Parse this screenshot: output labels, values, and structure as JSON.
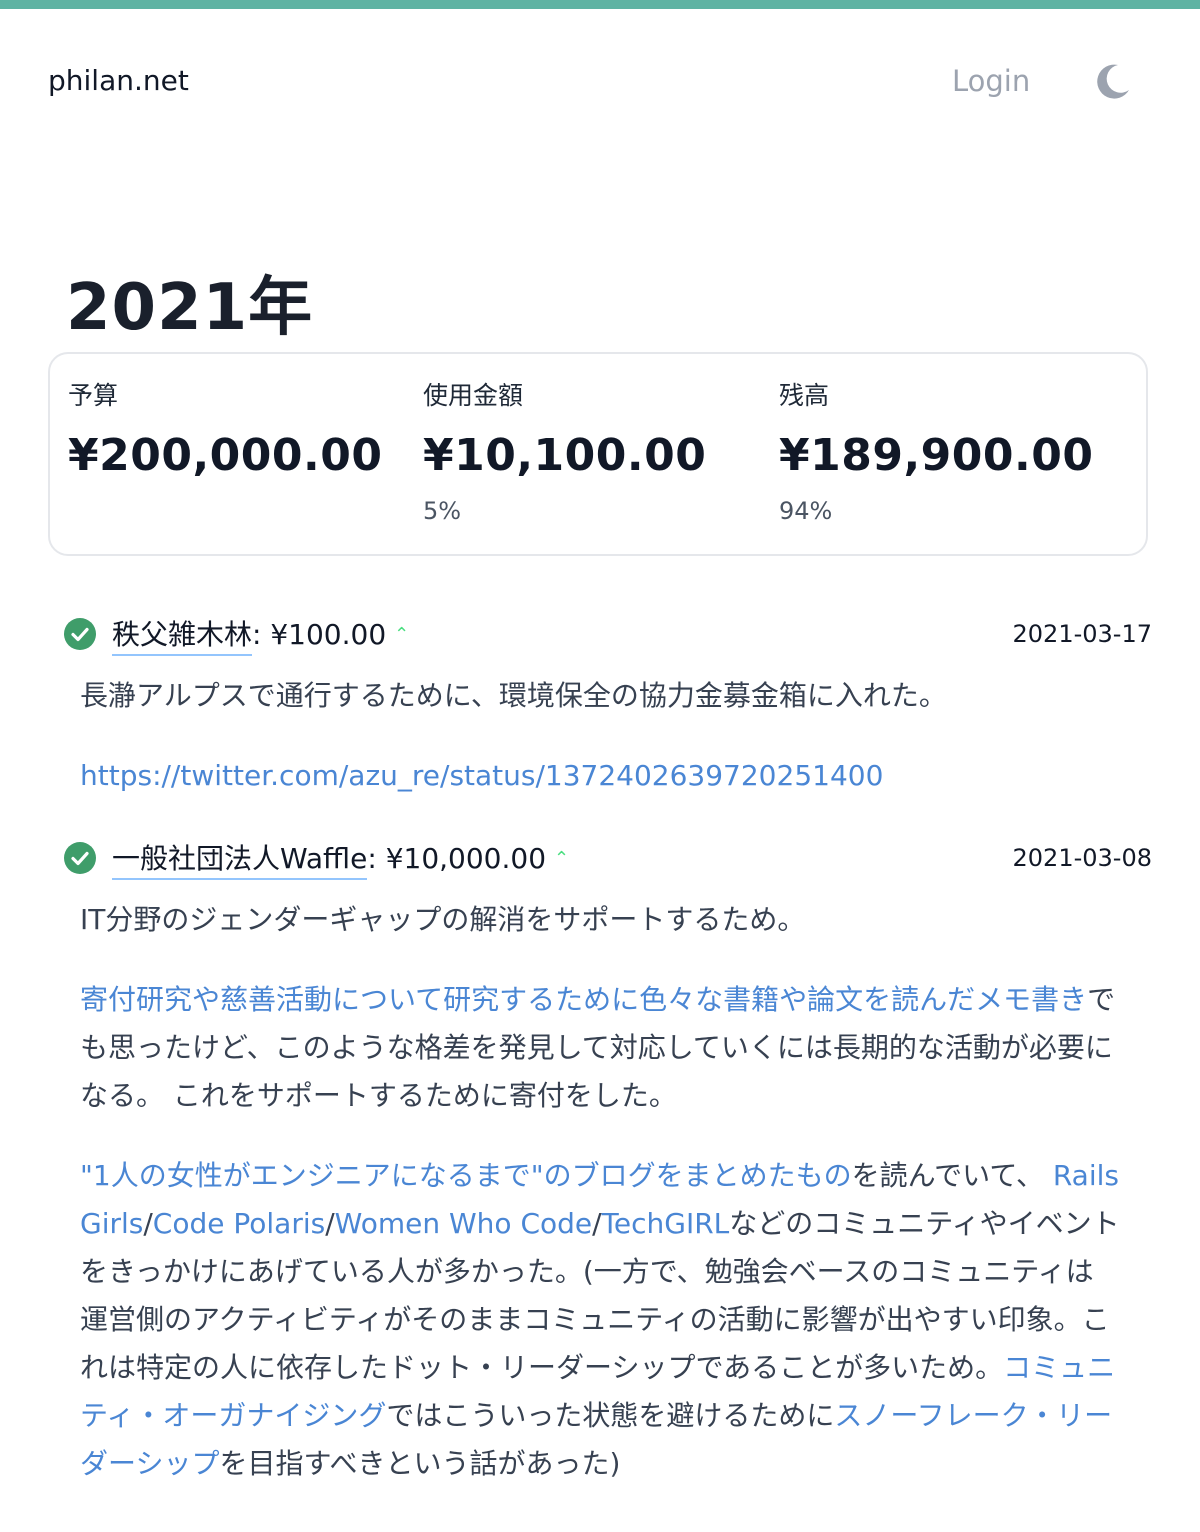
{
  "header": {
    "site_title": "philan.net",
    "login_label": "Login",
    "theme_icon": "moon-icon",
    "accent_color": "#5fb3a3"
  },
  "page": {
    "year_title": "2021年"
  },
  "summary": {
    "budget_label": "予算",
    "budget_value": "¥200,000.00",
    "spent_label": "使用金額",
    "spent_value": "¥10,100.00",
    "spent_pct": "5%",
    "remaining_label": "残高",
    "remaining_value": "¥189,900.00",
    "remaining_pct": "94%"
  },
  "entries": [
    {
      "status_icon": "check-circle-icon",
      "org": "秩父雑木林",
      "amount": ": ¥100.00",
      "date": "2021-03-17",
      "body": "長瀞アルプスで通行するために、環境保全の協力金募金箱に入れた。",
      "link": "https://twitter.com/azu_re/status/1372402639720251400"
    },
    {
      "status_icon": "check-circle-icon",
      "org": "一般社団法人Waffle",
      "amount": " : ¥10,000.00",
      "date": "2021-03-08",
      "body": "IT分野のジェンダーギャップの解消をサポートするため。",
      "p2_link": "寄付研究や慈善活動について研究するために色々な書籍や論文を読んだメモ書き",
      "p2_text": "でも思ったけど、このような格差を発見して対応していくには長期的な活動が必要になる。 これをサポートするために寄付をした。",
      "p3_link1": "\"1人の女性がエンジニアになるまで\"のブログをまとめたもの",
      "p3_text1": "を読んでいて、 ",
      "p3_link2": "Rails Girls",
      "p3_link3": "Code Polaris",
      "p3_link4": "Women Who Code",
      "p3_link5": "TechGIRL",
      "p3_sep": "/",
      "p3_text2": "などのコミュニティやイベントをきっかけにあげている人が多かった。(一方で、勉強会ベースのコミュニティは運営側のアクティビティがそのままコミュニティの活動に影響が出やすい印象。これは特定の人に依存したドット・リーダーシップであることが多いため。",
      "p3_link6": "コミュニティ・オーガナイジング",
      "p3_text3": "ではこういった状態を避けるために",
      "p3_link7": "スノーフレーク・リーダーシップ",
      "p3_text4": "を目指すべきという話があった)"
    }
  ]
}
